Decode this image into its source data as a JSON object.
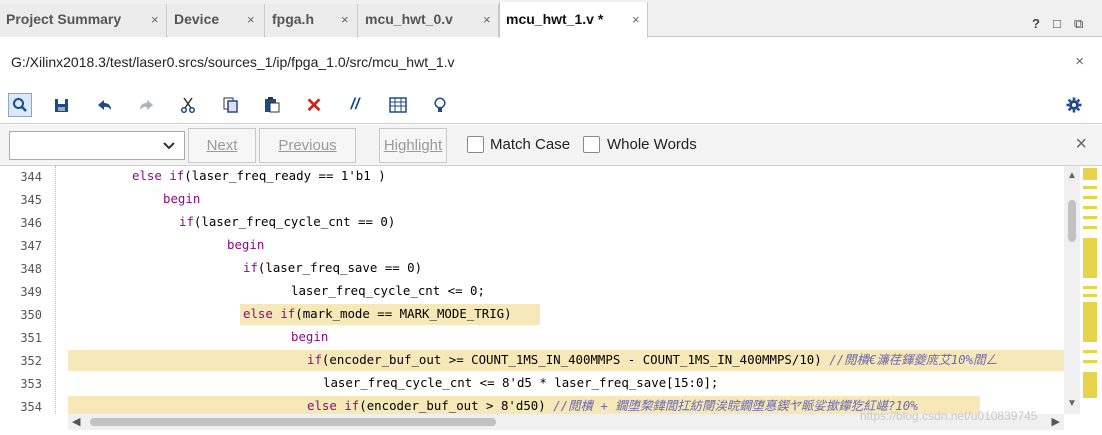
{
  "tabs": [
    {
      "label": "Project Summary",
      "close": "×"
    },
    {
      "label": "Device",
      "close": "×"
    },
    {
      "label": "fpga.h",
      "close": "×"
    },
    {
      "label": "mcu_hwt_0.v",
      "close": "×"
    },
    {
      "label": "mcu_hwt_1.v *",
      "close": "×"
    }
  ],
  "tab_controls": {
    "help": "?",
    "restore": "□",
    "maximize": "⧉"
  },
  "file_path": "G:/Xilinx2018.3/test/laser0.srcs/sources_1/ip/fpga_1.0/src/mcu_hwt_1.v",
  "path_close": "×",
  "toolbar_icons": [
    "search-icon",
    "save-icon",
    "undo-icon",
    "redo-icon",
    "cut-icon",
    "copy-icon",
    "paste-icon",
    "delete-icon",
    "comment-icon",
    "column-select-icon",
    "lightbulb-icon",
    "gear-icon"
  ],
  "find": {
    "selected_value": "",
    "next_label": "Next",
    "previous_label": "Previous",
    "highlight_label": "Highlight",
    "match_case_label": "Match Case",
    "whole_words_label": "Whole Words",
    "close": "×"
  },
  "code": {
    "line_numbers": [
      "344",
      "345",
      "346",
      "347",
      "348",
      "349",
      "350",
      "351",
      "352",
      "353",
      "354"
    ],
    "lines": [
      "else if(laser_freq_ready == 1'b1 )",
      "begin",
      "if(laser_freq_cycle_cnt == 0)",
      "begin",
      "if(laser_freq_save == 0)",
      "laser_freq_cycle_cnt <= 0;",
      "else if(mark_mode == MARK_MODE_TRIG)",
      "begin",
      "if(encoder_buf_out >= COUNT_1MS_IN_400MMPS - COUNT_1MS_IN_400MMPS/10) //閲樻€濂荏鍕夔庣艾10%閻ㄥ",
      "laser_freq_cycle_cnt <= 8'd5 * laser_freq_save[15:0];",
      "else if(encoder_buf_out > 8'd50) //閲樻 + 鐗堕棃鍏閭扛紡閿涘睆鐗堕惪鍥ヤ眽娑撳鑻犵紅嵁?10%"
    ]
  },
  "colors": {
    "highlight": "#f6e8b8",
    "keyword": "#8a0a8a",
    "comment": "#6a6ab0",
    "marker": "#e8d44a"
  },
  "watermark": "https://blog.csdn.net/u010839745"
}
